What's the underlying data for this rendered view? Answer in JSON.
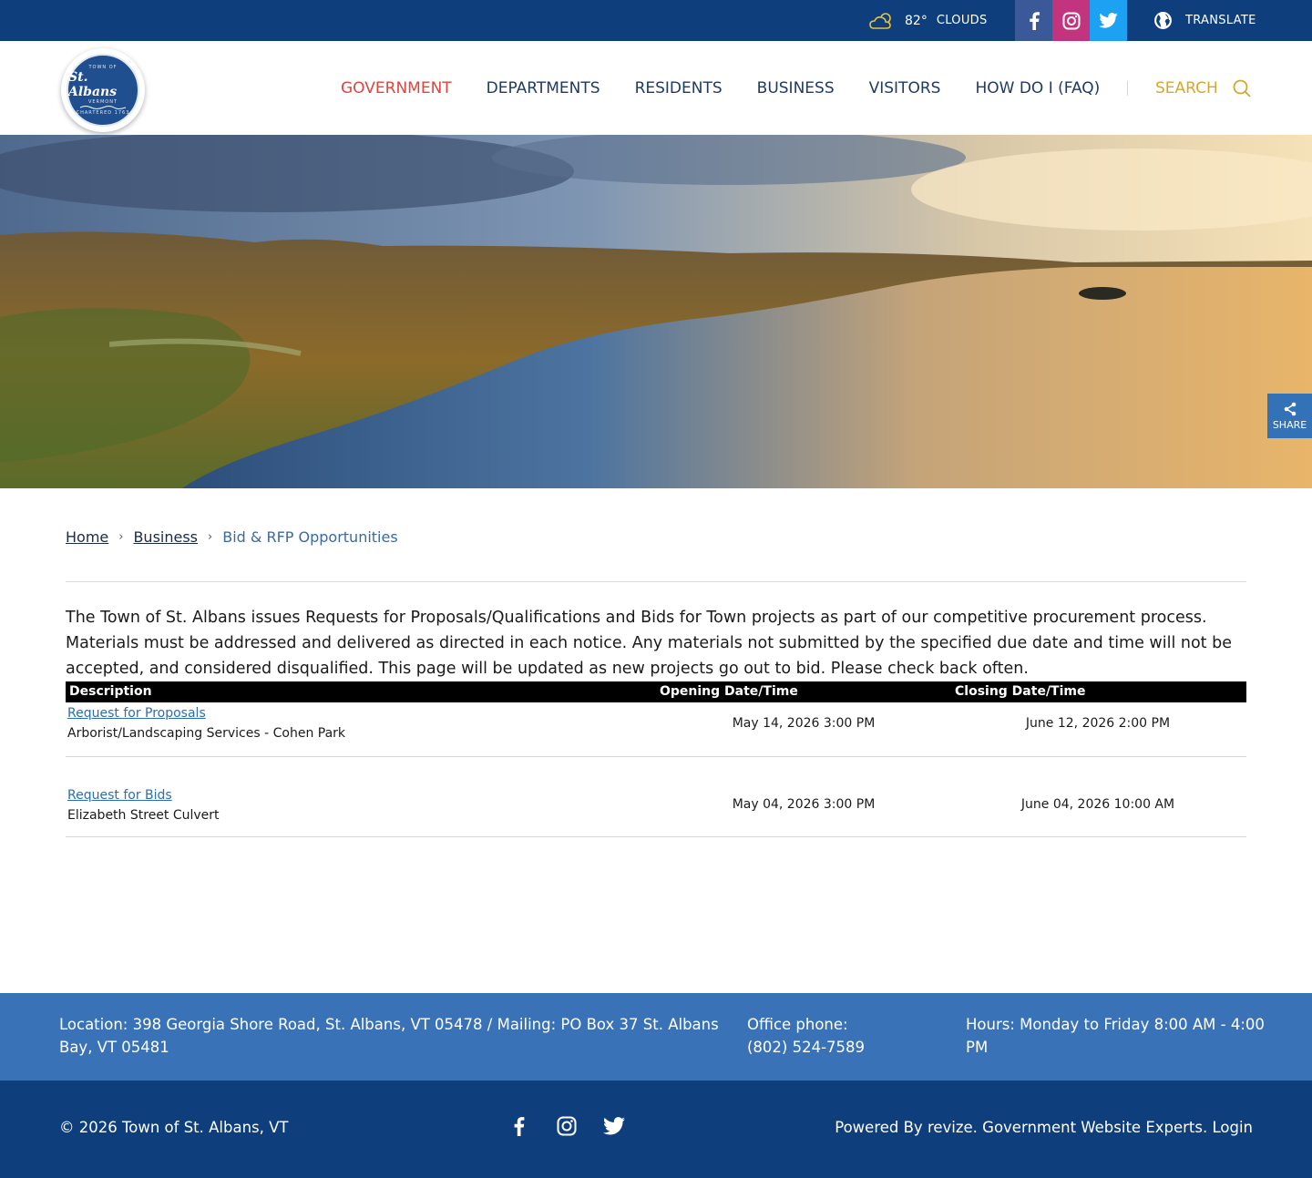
{
  "topbar": {
    "weather_icon": "cloud-sun-icon",
    "temperature": "82°",
    "condition": "CLOUDS",
    "social": [
      "facebook-icon",
      "instagram-icon",
      "twitter-icon"
    ],
    "translate_label": "TRANSLATE"
  },
  "header": {
    "logo": {
      "top": "TOWN OF",
      "name": "St. Albans",
      "state": "VERMONT",
      "bottom": "CHARTERED 1763"
    },
    "nav": [
      "GOVERNMENT",
      "DEPARTMENTS",
      "RESIDENTS",
      "BUSINESS",
      "VISITORS",
      "HOW DO I (FAQ)"
    ],
    "active_nav": "GOVERNMENT",
    "search_label": "SEARCH"
  },
  "share_label": "SHARE",
  "breadcrumb": {
    "home": "Home",
    "business": "Business",
    "current": "Bid & RFP Opportunities"
  },
  "intro": "The Town of St. Albans issues Requests for Proposals/Qualifications and Bids for Town projects as part of our competitive procurement process. Materials must be addressed and delivered as directed in each notice. Any materials not submitted by the specified due date and time will not be accepted, and considered disqualified.  This page will be updated as new projects go out to bid.  Please check back often.",
  "table": {
    "headers": {
      "description": "Description",
      "opening": "Opening Date/Time",
      "closing": "Closing Date/Time"
    },
    "rows": [
      {
        "link": "Request for Proposals",
        "title": "Arborist/Landscaping Services - Cohen Park",
        "opening": "May 14, 2026 3:00 PM",
        "closing": "June 12, 2026 2:00 PM"
      },
      {
        "link": "Request for Bids",
        "title": "Elizabeth Street Culvert",
        "opening": "May 04, 2026 3:00 PM",
        "closing": "June 04, 2026 10:00 AM"
      }
    ]
  },
  "footer": {
    "location": "Location: 398 Georgia Shore Road, St. Albans, VT 05478 / Mailing: PO Box 37 St. Albans Bay, VT 05481",
    "phone_label": "Office phone:",
    "phone": "(802) 524-7589",
    "hours": "Hours: Monday to Friday 8:00 AM - 4:00 PM",
    "copyright": "© 2026 Town of St. Albans, VT",
    "powered": "Powered By revize. Government Website Experts. Login"
  },
  "colors": {
    "topbar": "#0e3f7c",
    "accent_red": "#e0443d",
    "search_gold": "#d4a82b",
    "footer_blue": "#3a72b8"
  }
}
